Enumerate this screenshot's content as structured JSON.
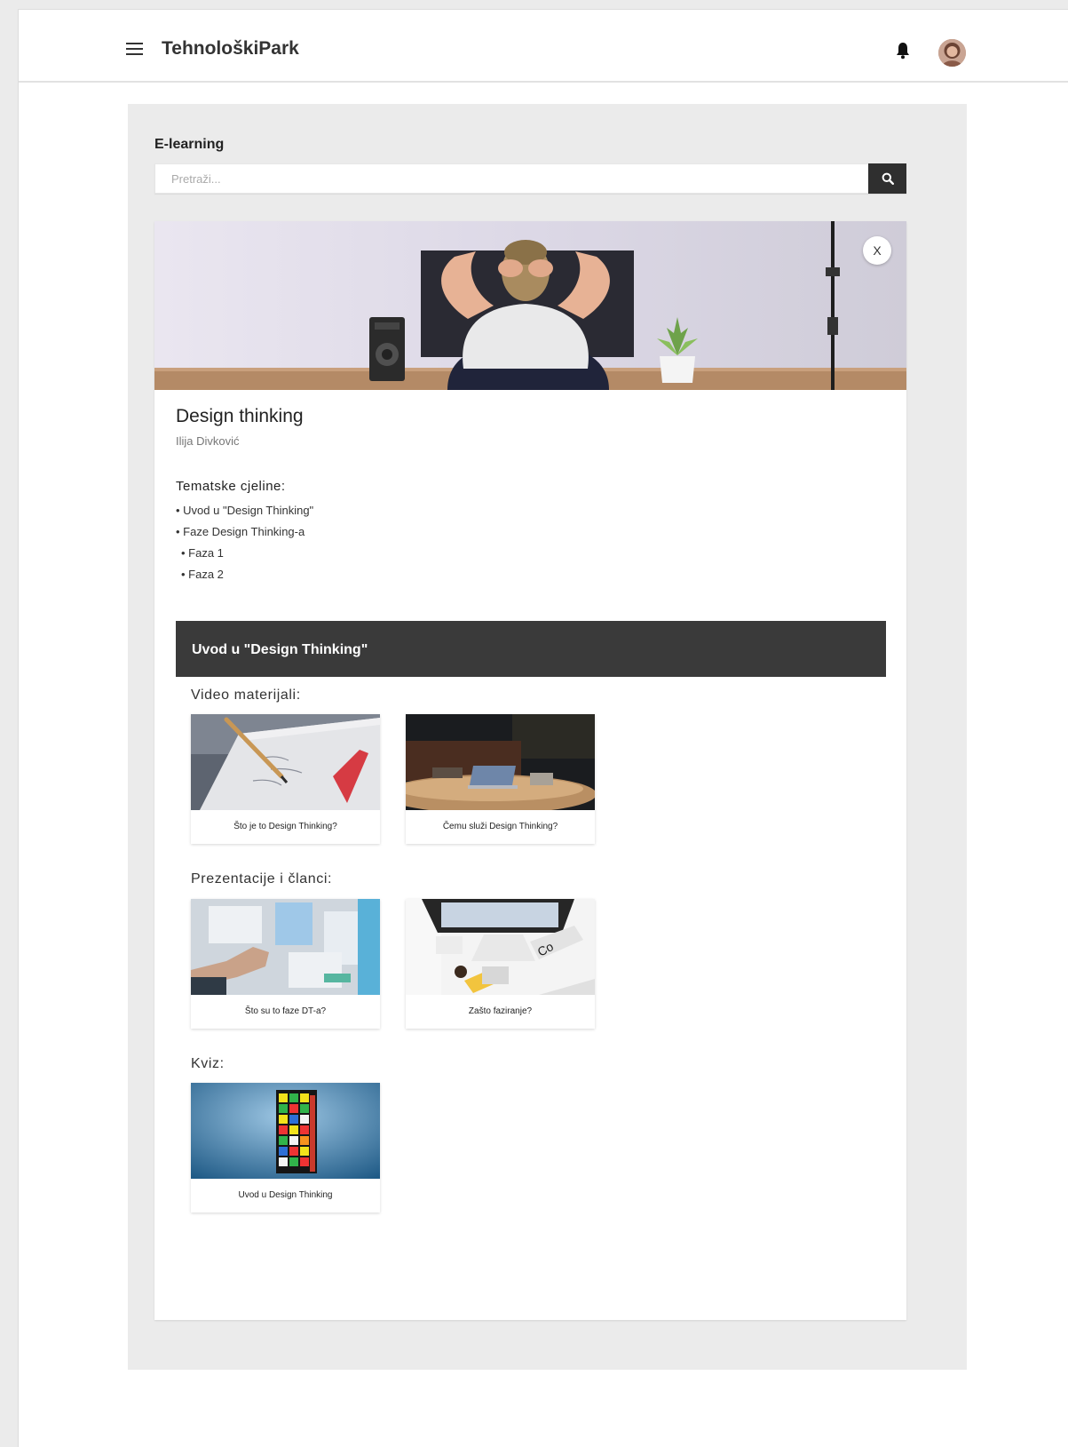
{
  "header": {
    "app_title": "TehnološkiPark",
    "icons": [
      "menu-icon",
      "bell-icon",
      "avatar"
    ]
  },
  "page": {
    "section_title": "E-learning",
    "search": {
      "placeholder": "Pretraži...",
      "value": ""
    }
  },
  "course": {
    "close_label": "X",
    "title": "Design thinking",
    "author": "Ilija Divković",
    "topics_heading": "Tematske cjeline:",
    "topics": [
      "• Uvod u \"Design Thinking\"",
      "• Faze Design Thinking-a",
      "• Faza 1",
      "• Faza 2"
    ],
    "module": {
      "title": "Uvod u \"Design Thinking\"",
      "video_label": "Video materijali:",
      "videos": [
        "Što je to Design Thinking?",
        "Čemu služi Design Thinking?"
      ],
      "presentations_label": "Prezentacije i članci:",
      "presentations": [
        "Što su to faze DT-a?",
        "Zašto faziranje?"
      ],
      "quiz_label": "Kviz:",
      "quizzes": [
        "Uvod u Design Thinking"
      ]
    }
  },
  "colors": {
    "background": "#ebebeb",
    "module_bar": "#3a3a3a",
    "search_button": "#2f2f2f"
  }
}
